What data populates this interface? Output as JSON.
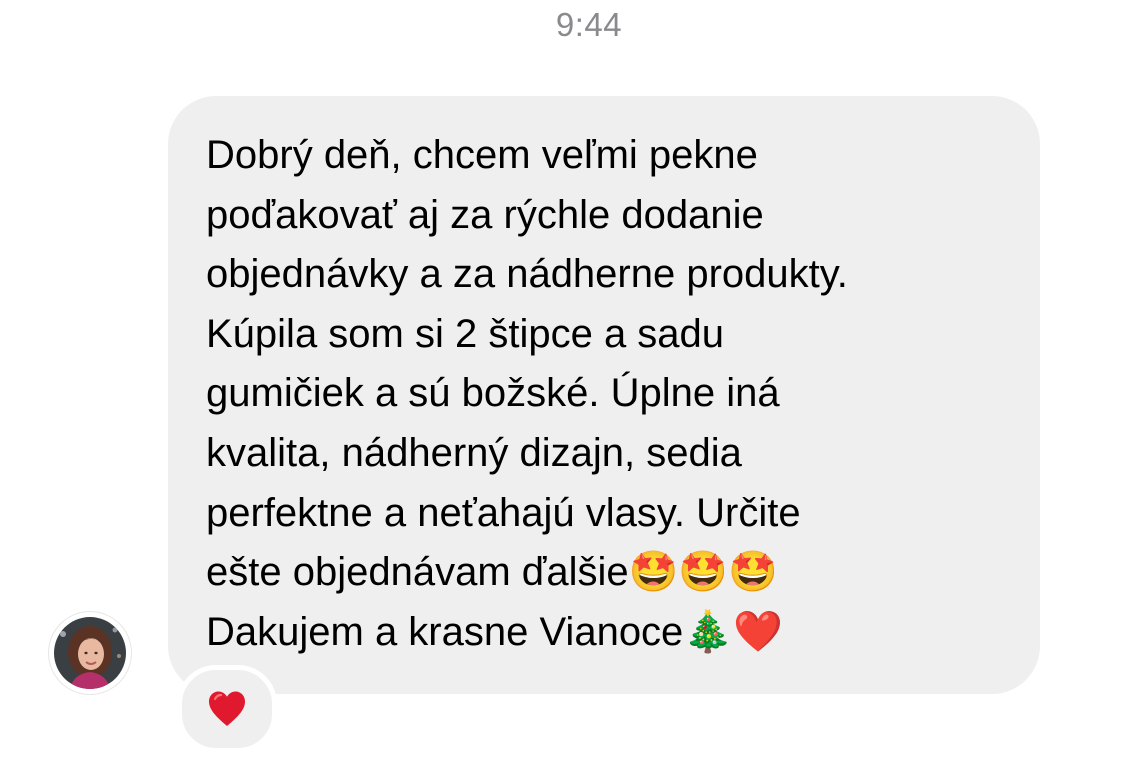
{
  "timestamp": "9:44",
  "message": {
    "lines": [
      "Dobrý deň, chcem veľmi pekne",
      "poďakovať aj za rýchle dodanie",
      "objednávky a za nádherne produkty.",
      "Kúpila som si 2 štipce a sadu",
      "gumičiek a sú božské. Úplne iná",
      "kvalita, nádherný dizajn, sedia",
      "perfektne a neťahajú vlasy. Určite",
      "ešte objednávam ďalšie🤩🤩🤩",
      "Dakujem a krasne Vianoce🎄❤️"
    ],
    "bubble_color": "#efeff0",
    "text_color": "#000000"
  },
  "sender": {
    "avatar_icon": "profile-photo-avatar"
  },
  "reaction": {
    "icon": "red-heart-icon",
    "color": "#e0192e"
  }
}
